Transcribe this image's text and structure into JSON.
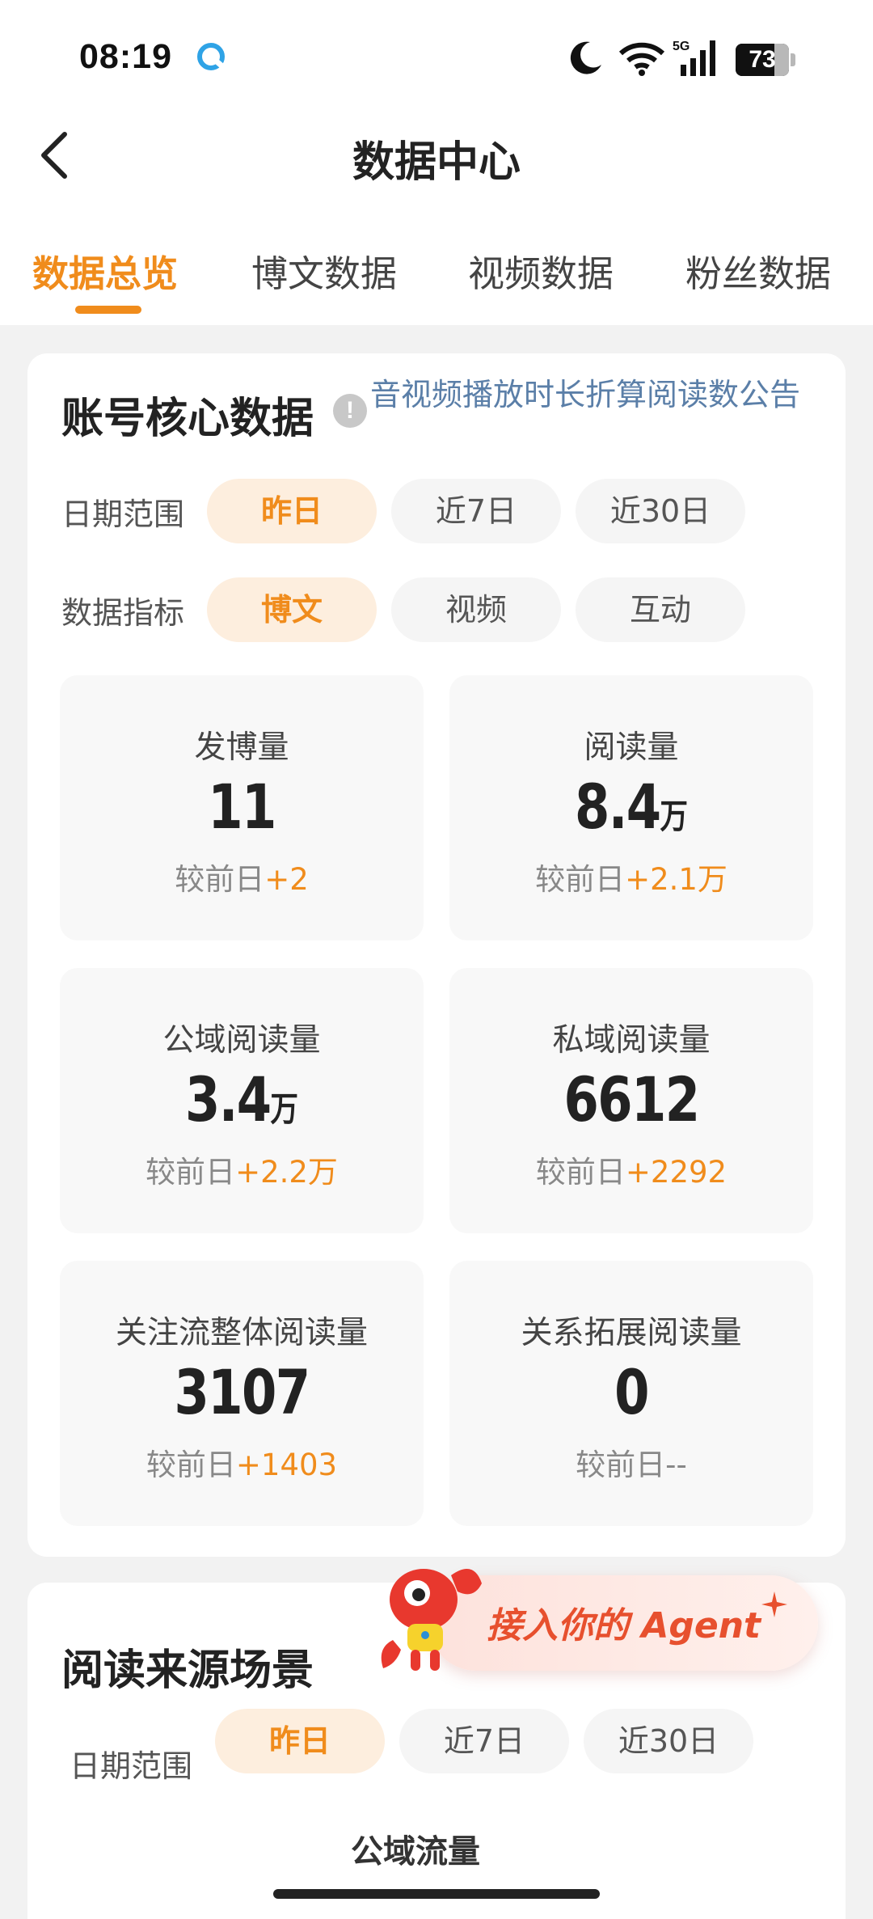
{
  "status_bar": {
    "time": "08:19",
    "battery_level": "73",
    "icons": [
      "app-icon",
      "moon-icon",
      "wifi-icon",
      "signal-5g-icon",
      "battery-icon"
    ]
  },
  "header": {
    "title": "数据中心",
    "back_icon": "chevron-left-icon"
  },
  "tabs": [
    {
      "label": "数据总览",
      "active": true
    },
    {
      "label": "博文数据",
      "active": false
    },
    {
      "label": "视频数据",
      "active": false
    },
    {
      "label": "粉丝数据",
      "active": false
    }
  ],
  "core_card": {
    "title": "账号核心数据",
    "info_icon": "!",
    "notice_link": "音视频播放时长折算阅读数公告",
    "date_range": {
      "label": "日期范围",
      "options": [
        "昨日",
        "近7日",
        "近30日"
      ],
      "selected": "昨日"
    },
    "metric": {
      "label": "数据指标",
      "options": [
        "博文",
        "视频",
        "互动"
      ],
      "selected": "博文"
    },
    "compare_prefix": "较前日",
    "stats": [
      {
        "label": "发博量",
        "value": "11",
        "unit": "",
        "delta": "+2"
      },
      {
        "label": "阅读量",
        "value": "8.4",
        "unit": "万",
        "delta": "+2.1万"
      },
      {
        "label": "公域阅读量",
        "value": "3.4",
        "unit": "万",
        "delta": "+2.2万"
      },
      {
        "label": "私域阅读量",
        "value": "6612",
        "unit": "",
        "delta": "+2292"
      },
      {
        "label": "关注流整体阅读量",
        "value": "3107",
        "unit": "",
        "delta": "+1403"
      },
      {
        "label": "关系拓展阅读量",
        "value": "0",
        "unit": "",
        "delta": "--"
      }
    ]
  },
  "source_card": {
    "title": "阅读来源场景",
    "date_range": {
      "label": "日期范围",
      "options": [
        "昨日",
        "近7日",
        "近30日"
      ],
      "selected": "昨日"
    },
    "sub_heading": "公域流量"
  },
  "agent_bubble": {
    "text": "接入你的 Agent",
    "mascot_icon": "crab-mascot-icon",
    "sparkle_icon": "sparkle-icon",
    "accent": "#e7502e"
  },
  "colors": {
    "accent": "#f08c1c",
    "link": "#5b7fa8",
    "pill_active_bg": "#fdeede"
  }
}
